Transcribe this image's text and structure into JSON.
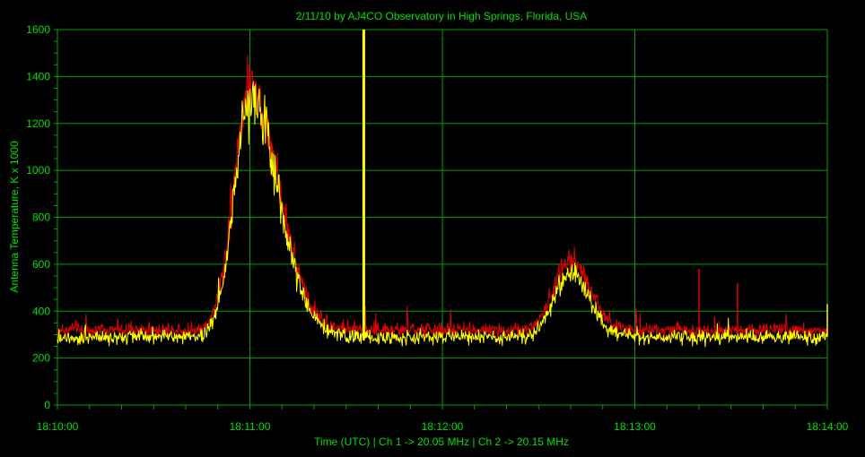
{
  "chart_data": {
    "type": "line",
    "title": "2/11/10  by  AJ4CO Observatory  in  High Springs, Florida, USA",
    "xlabel": "Time (UTC)  |  Ch 1 -> 20.05 MHz  |  Ch 2 -> 20.15 MHz",
    "ylabel": "Antenna Temperature, K x 1000",
    "xlim_seconds": [
      0,
      240
    ],
    "ylim": [
      0,
      1600
    ],
    "yticks": [
      0,
      200,
      400,
      600,
      800,
      1000,
      1200,
      1400,
      1600
    ],
    "xtick_labels": [
      "18:10:00",
      "18:11:00",
      "18:12:00",
      "18:13:00",
      "18:14:00"
    ],
    "xtick_seconds": [
      0,
      60,
      120,
      180,
      240
    ],
    "grid": true,
    "colors": {
      "background": "#000000",
      "grid": "#00a000",
      "text": "#00e000",
      "ch1": "#e00000",
      "ch2": "#ffff00"
    },
    "series": [
      {
        "name": "Ch 1 -> 20.05 MHz",
        "color": "#e00000",
        "baseline": 320,
        "peaks": [
          {
            "center": 60,
            "amplitude": 1030,
            "width_left": 5,
            "width_right": 9
          },
          {
            "center": 160,
            "amplitude": 300,
            "width_left": 5,
            "width_right": 6
          }
        ],
        "spikes": [
          {
            "x": 200,
            "value": 580
          },
          {
            "x": 212,
            "value": 520
          }
        ]
      },
      {
        "name": "Ch 2 -> 20.15 MHz",
        "color": "#ffff00",
        "baseline": 290,
        "peaks": [
          {
            "center": 60,
            "amplitude": 1010,
            "width_left": 5,
            "width_right": 9
          },
          {
            "center": 160,
            "amplitude": 270,
            "width_left": 5,
            "width_right": 6
          }
        ],
        "spikes": [
          {
            "x": 95.5,
            "value": 1600
          },
          {
            "x": 240,
            "value": 430
          }
        ]
      }
    ]
  }
}
